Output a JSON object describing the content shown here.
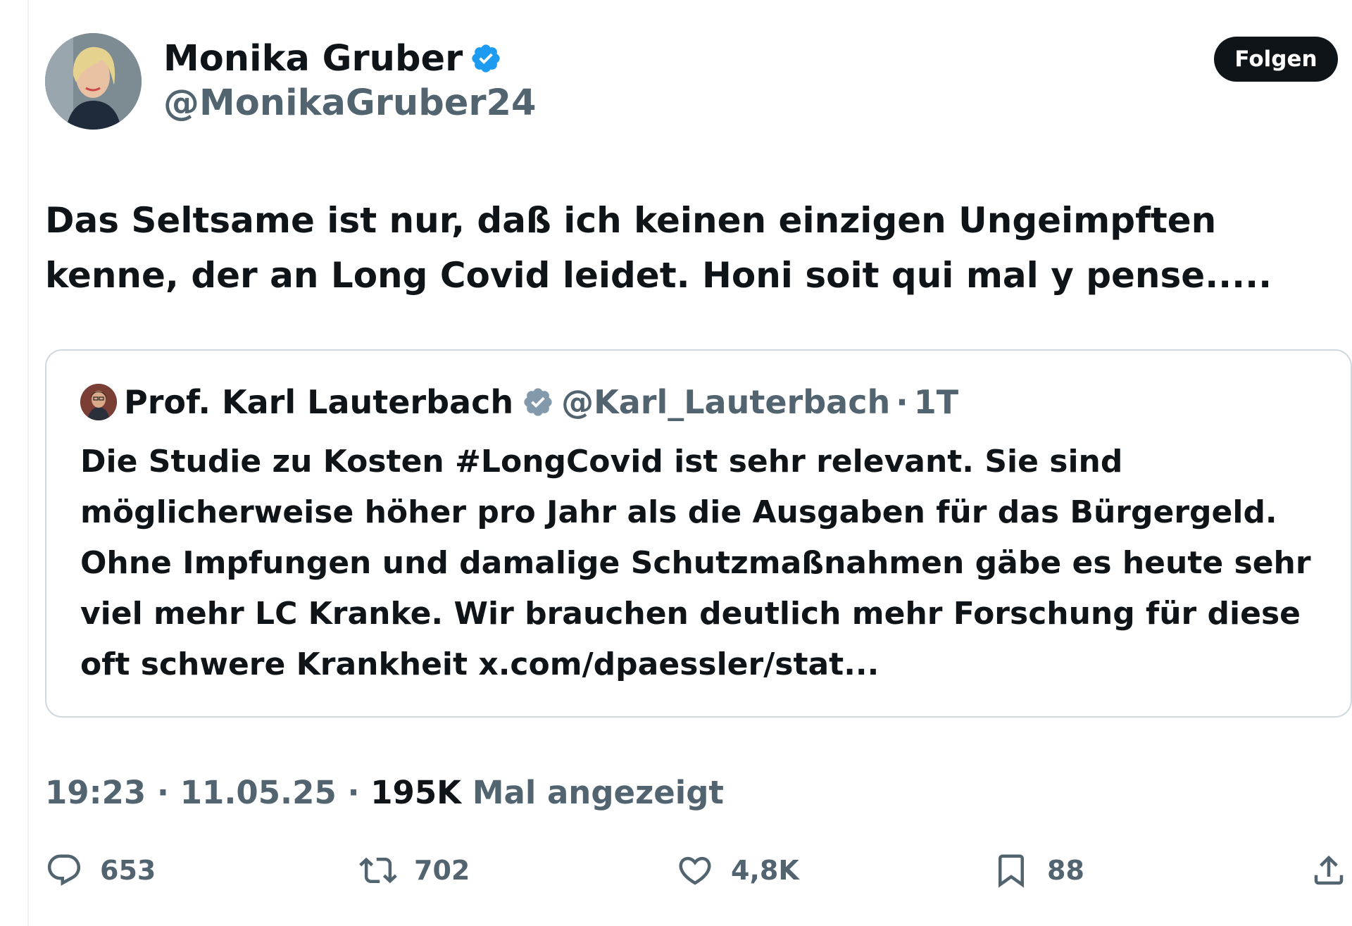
{
  "tweet": {
    "author": {
      "name": "Monika Gruber",
      "handle": "@MonikaGruber24"
    },
    "follow_label": "Folgen",
    "text": "Das Seltsame ist nur, daß ich keinen einzigen Ungeimpften kenne, der an Long Covid leidet. Honi soit qui mal y pense.....",
    "quote": {
      "name": "Prof. Karl Lauterbach",
      "handle": "@Karl_Lauterbach",
      "separator": "·",
      "time": "1T",
      "text": "Die Studie zu Kosten #LongCovid ist sehr relevant. Sie sind möglicherweise höher pro Jahr als die Ausgaben für das Bürgergeld. Ohne Impfungen und damalige Schutzmaßnahmen gäbe es heute sehr viel mehr LC Kranke. Wir brauchen deutlich mehr Forschung für diese oft schwere Krankheit x.com/dpaessler/stat..."
    },
    "meta": {
      "time": "19:23",
      "date": "11.05.25",
      "separator": "·",
      "views": "195K",
      "views_label": "Mal angezeigt"
    },
    "actions": {
      "replies": "653",
      "reposts": "702",
      "likes": "4,8K",
      "bookmarks": "88"
    }
  },
  "icons": {
    "verified": "verified-badge-icon",
    "quote_verified": "verified-badge-icon",
    "reply": "reply-icon",
    "repost": "repost-icon",
    "like": "heart-icon",
    "bookmark": "bookmark-icon",
    "share": "share-icon"
  },
  "colors": {
    "primary_text": "#0f1419",
    "secondary_text": "#536471",
    "verified_blue": "#1d9bf0",
    "quote_verified_gray": "#829aab",
    "follow_button_bg": "#0f1419",
    "border": "#cfd9de"
  }
}
